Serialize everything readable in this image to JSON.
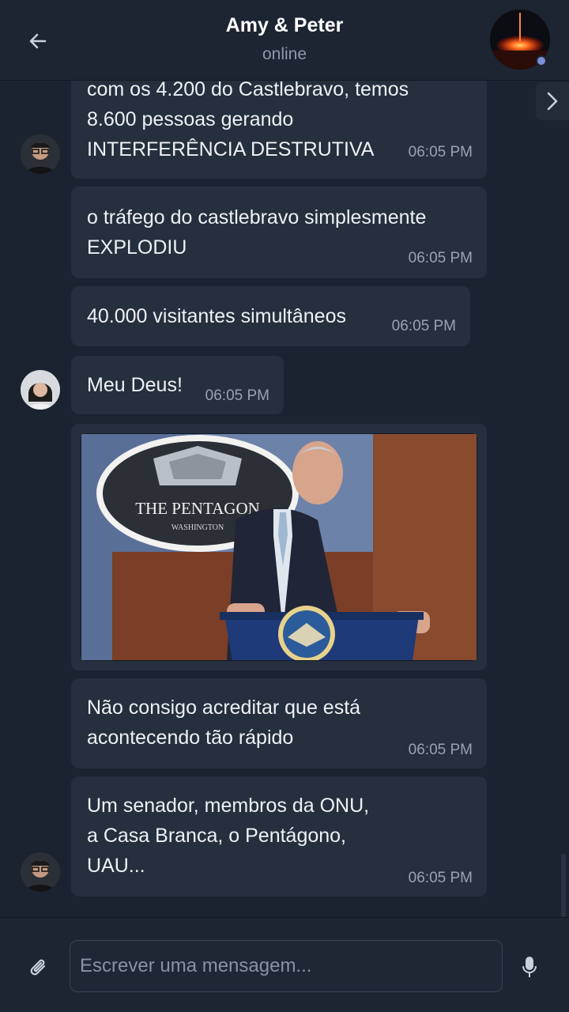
{
  "header": {
    "title": "Amy & Peter",
    "status": "online"
  },
  "messages": [
    {
      "text": "com os 4.200 do Castlebravo, temos\n8.600 pessoas gerando\nINTERFERÊNCIA DESTRUTIVA",
      "time": "06:05 PM"
    },
    {
      "text": "o tráfego do castlebravo simplesmente\nEXPLODIU",
      "time": "06:05 PM"
    },
    {
      "text": "40.000 visitantes simultâneos",
      "time": "06:05 PM"
    },
    {
      "text": "Meu Deus!",
      "time": "06:05 PM"
    },
    {
      "image_caption": "THE PENTAGON",
      "image_subcaption": "WASHINGTON"
    },
    {
      "text": "Não consigo acreditar que está\nacontecendo tão rápido",
      "time": "06:05 PM"
    },
    {
      "text": "Um senador, membros da ONU,\na Casa Branca, o Pentágono,\nUAU...",
      "time": "06:05 PM"
    }
  ],
  "composer": {
    "placeholder": "Escrever uma mensagem..."
  },
  "icons": {
    "back": "arrow-left-icon",
    "attach": "paperclip-icon",
    "mic": "microphone-icon",
    "next": "chevron-right-icon"
  },
  "colors": {
    "background": "#1b2330",
    "bubble": "#262f3d",
    "header": "#1d2532",
    "online_dot": "#7f8fd6"
  }
}
